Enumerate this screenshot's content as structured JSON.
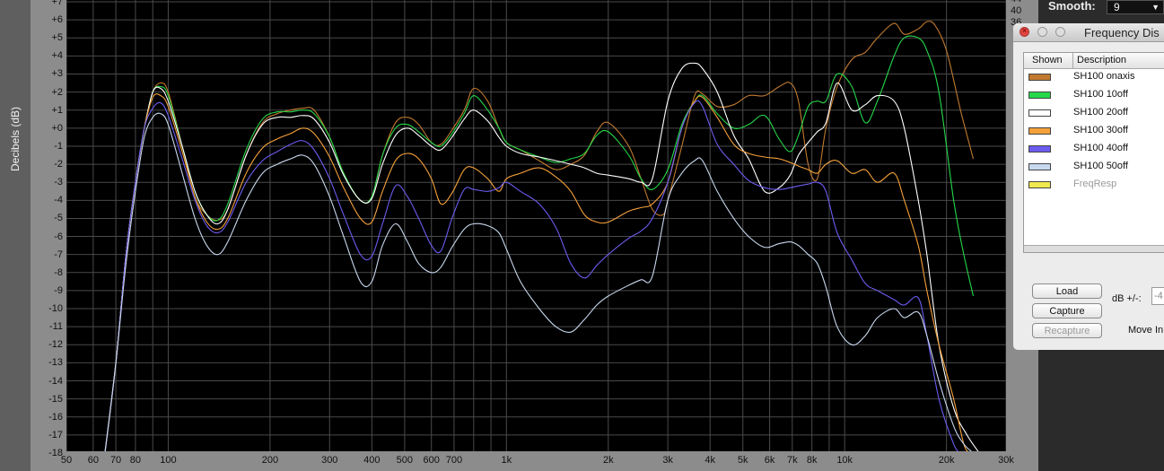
{
  "window_title": "Frequency Dis",
  "smooth": {
    "label": "Smooth:",
    "value": "9"
  },
  "table": {
    "columns": [
      "Shown",
      "Description"
    ],
    "rows": [
      {
        "label": "SH100 onaxis",
        "color": "#c27a2f",
        "dimmed": false
      },
      {
        "label": "SH100 10off",
        "color": "#25d84a",
        "dimmed": false
      },
      {
        "label": "SH100 20off",
        "color": "#ffffff",
        "dimmed": false
      },
      {
        "label": "SH100 30off",
        "color": "#f5a13a",
        "dimmed": false
      },
      {
        "label": "SH100 40off",
        "color": "#6c5cf0",
        "dimmed": false
      },
      {
        "label": "SH100 50off",
        "color": "#c8d8ee",
        "dimmed": false
      },
      {
        "label": "FreqResp",
        "color": "#f0e84c",
        "dimmed": true
      }
    ]
  },
  "buttons": {
    "load": "Load",
    "capture": "Capture",
    "recapture": "Recapture"
  },
  "db_label": "dB +/-:",
  "db_value": "-4",
  "move_label": "Move In",
  "right_axis_ticks": [
    "44",
    "40",
    "36"
  ],
  "chart_data": {
    "type": "line",
    "xscale": "log",
    "xlim": [
      50,
      30000
    ],
    "ylim": [
      -18,
      7
    ],
    "ylabel": "Decibels (dB)",
    "x_ticks": [
      {
        "v": 50,
        "t": "50"
      },
      {
        "v": 60,
        "t": "60"
      },
      {
        "v": 70,
        "t": "70"
      },
      {
        "v": 80,
        "t": "80"
      },
      {
        "v": 100,
        "t": "100"
      },
      {
        "v": 200,
        "t": "200"
      },
      {
        "v": 300,
        "t": "300"
      },
      {
        "v": 400,
        "t": "400"
      },
      {
        "v": 500,
        "t": "500"
      },
      {
        "v": 600,
        "t": "600"
      },
      {
        "v": 700,
        "t": "700"
      },
      {
        "v": 1000,
        "t": "1k"
      },
      {
        "v": 2000,
        "t": "2k"
      },
      {
        "v": 3000,
        "t": "3k"
      },
      {
        "v": 4000,
        "t": "4k"
      },
      {
        "v": 5000,
        "t": "5k"
      },
      {
        "v": 6000,
        "t": "6k"
      },
      {
        "v": 7000,
        "t": "7k"
      },
      {
        "v": 8000,
        "t": "8k"
      },
      {
        "v": 10000,
        "t": "10k"
      },
      {
        "v": 20000,
        "t": "20k"
      },
      {
        "v": 30000,
        "t": "30k"
      }
    ],
    "y_ticks": [
      {
        "v": 7,
        "t": "+7"
      },
      {
        "v": 6,
        "t": "+6"
      },
      {
        "v": 5,
        "t": "+5"
      },
      {
        "v": 4,
        "t": "+4"
      },
      {
        "v": 3,
        "t": "+3"
      },
      {
        "v": 2,
        "t": "+2"
      },
      {
        "v": 1,
        "t": "+1"
      },
      {
        "v": 0,
        "t": "+0"
      },
      {
        "v": -1,
        "t": "-1"
      },
      {
        "v": -2,
        "t": "-2"
      },
      {
        "v": -3,
        "t": "-3"
      },
      {
        "v": -4,
        "t": "-4"
      },
      {
        "v": -5,
        "t": "-5"
      },
      {
        "v": -6,
        "t": "-6"
      },
      {
        "v": -7,
        "t": "-7"
      },
      {
        "v": -8,
        "t": "-8"
      },
      {
        "v": -9,
        "t": "-9"
      },
      {
        "v": -10,
        "t": "-10"
      },
      {
        "v": -11,
        "t": "-11"
      },
      {
        "v": -12,
        "t": "-12"
      },
      {
        "v": -13,
        "t": "-13"
      },
      {
        "v": -14,
        "t": "-14"
      },
      {
        "v": -15,
        "t": "-15"
      },
      {
        "v": -16,
        "t": "-16"
      },
      {
        "v": -17,
        "t": "-17"
      },
      {
        "v": -18,
        "t": "-18"
      }
    ],
    "grid": true,
    "series": [
      {
        "name": "SH100 onaxis",
        "color": "#c27a2f",
        "x": [
          65,
          70,
          75,
          80,
          85,
          90,
          95,
          100,
          110,
          120,
          130,
          140,
          150,
          170,
          190,
          210,
          230,
          250,
          270,
          300,
          330,
          370,
          400,
          430,
          470,
          510,
          550,
          600,
          640,
          690,
          750,
          800,
          880,
          950,
          1000,
          1100,
          1250,
          1400,
          1550,
          1700,
          1850,
          2000,
          2300,
          2500,
          2700,
          2900,
          3000,
          3300,
          3600,
          3800,
          4200,
          4700,
          5200,
          5800,
          6400,
          6900,
          7300,
          7800,
          8300,
          8800,
          9500,
          10500,
          11500,
          12500,
          14000,
          15000,
          16500,
          17500,
          18500,
          20000,
          22000,
          24000
        ],
        "y": [
          -18,
          -13,
          -7,
          -3,
          0,
          2,
          2.5,
          2,
          -1,
          -3.8,
          -4.8,
          -5.1,
          -4.5,
          -1.5,
          0.3,
          0.8,
          1,
          1.1,
          1,
          -0.5,
          -2.5,
          -4,
          -3.8,
          -1.5,
          0.3,
          0.6,
          0.2,
          -0.8,
          -0.9,
          -0.1,
          1,
          2.2,
          1.5,
          0,
          -0.8,
          -1.2,
          -1.8,
          -2.3,
          -2,
          -1.5,
          -0.2,
          0.3,
          -1,
          -2.8,
          -4.5,
          -4.8,
          -4,
          -1,
          1.8,
          1.9,
          1.2,
          1.3,
          1.8,
          1.8,
          2.3,
          2.5,
          1.5,
          -2,
          -2.8,
          0,
          2.3,
          3.8,
          4.2,
          5,
          5.8,
          5.2,
          5.5,
          5.9,
          5.7,
          4.3,
          1,
          -1.7
        ]
      },
      {
        "name": "SH100 10off",
        "color": "#25d84a",
        "x": [
          65,
          70,
          75,
          80,
          85,
          90,
          95,
          100,
          110,
          120,
          130,
          140,
          150,
          170,
          190,
          210,
          230,
          250,
          270,
          300,
          330,
          370,
          400,
          430,
          470,
          510,
          550,
          600,
          640,
          690,
          750,
          800,
          880,
          950,
          1000,
          1100,
          1250,
          1400,
          1550,
          1700,
          1850,
          2000,
          2300,
          2500,
          2700,
          3000,
          3300,
          3600,
          3800,
          4200,
          4700,
          5200,
          5800,
          6400,
          6900,
          7300,
          7800,
          8300,
          8800,
          9500,
          10500,
          11500,
          12500,
          14000,
          15000,
          16500,
          17500,
          19000,
          21000,
          22500,
          24000
        ],
        "y": [
          -18,
          -13,
          -7,
          -3,
          0,
          2,
          2.3,
          1.8,
          -1,
          -3.5,
          -4.8,
          -5.1,
          -4.2,
          -1.2,
          0.5,
          0.9,
          0.9,
          1,
          0.8,
          -0.5,
          -2.5,
          -4,
          -3.8,
          -1.5,
          0,
          0.2,
          -0.2,
          -0.8,
          -1,
          -0.3,
          0.8,
          1.8,
          1,
          0,
          -0.8,
          -1.2,
          -1.6,
          -1.9,
          -1.7,
          -1.4,
          -0.4,
          -0.2,
          -1.5,
          -2.8,
          -3.4,
          -2.3,
          0.2,
          1.5,
          1.8,
          0.8,
          0,
          0.2,
          0.7,
          -0.6,
          -1.3,
          -0.4,
          1.2,
          1.5,
          1.5,
          3,
          2.3,
          0.3,
          1.5,
          4,
          5,
          5,
          4.3,
          2,
          -4,
          -7,
          -9.3
        ]
      },
      {
        "name": "SH100 20off",
        "color": "#ffffff",
        "x": [
          65,
          70,
          75,
          80,
          85,
          90,
          95,
          100,
          110,
          120,
          130,
          140,
          150,
          170,
          190,
          210,
          230,
          250,
          270,
          300,
          330,
          370,
          400,
          430,
          470,
          510,
          550,
          600,
          640,
          690,
          750,
          800,
          880,
          950,
          1000,
          1100,
          1250,
          1400,
          1550,
          1700,
          1850,
          2000,
          2300,
          2500,
          2700,
          3000,
          3300,
          3600,
          3800,
          4200,
          4700,
          5200,
          5800,
          6400,
          6900,
          7300,
          7800,
          8300,
          8800,
          9500,
          10500,
          11500,
          12500,
          14000,
          15000,
          16500,
          17500,
          19000,
          21000,
          23000,
          25000
        ],
        "y": [
          -18,
          -13,
          -7,
          -3,
          0,
          2,
          2.2,
          1.5,
          -1,
          -3.5,
          -4.8,
          -5.3,
          -4.5,
          -1.5,
          0.2,
          0.6,
          0.6,
          0.7,
          0.5,
          -0.8,
          -2.6,
          -4,
          -3.9,
          -2,
          -0.4,
          0,
          -0.4,
          -1,
          -1.2,
          -0.5,
          0.5,
          1,
          0.4,
          -0.5,
          -1,
          -1.4,
          -1.6,
          -1.8,
          -2,
          -2.2,
          -2.5,
          -2.6,
          -2.8,
          -3,
          -2.8,
          1.5,
          3.3,
          3.6,
          3.3,
          2,
          -0.4,
          -1.7,
          -3.5,
          -3.3,
          -2.6,
          -1.5,
          -0.8,
          -0.2,
          0.3,
          2.5,
          1,
          1.3,
          1.8,
          1.5,
          0,
          -4,
          -7,
          -12,
          -15.5,
          -17,
          -18
        ]
      },
      {
        "name": "SH100 30off",
        "color": "#f5a13a",
        "x": [
          65,
          70,
          75,
          80,
          85,
          90,
          95,
          100,
          110,
          120,
          130,
          140,
          150,
          170,
          190,
          210,
          230,
          250,
          270,
          300,
          330,
          370,
          400,
          430,
          470,
          510,
          550,
          600,
          640,
          690,
          750,
          800,
          880,
          950,
          1000,
          1100,
          1250,
          1400,
          1550,
          1700,
          1850,
          2000,
          2300,
          2500,
          2700,
          3000,
          3300,
          3600,
          3800,
          4200,
          4700,
          5200,
          5800,
          6400,
          6900,
          7300,
          7800,
          8300,
          8800,
          9500,
          10500,
          11500,
          12500,
          14000,
          15000,
          16500,
          17500,
          19000,
          21000,
          22500,
          23500
        ],
        "y": [
          -18,
          -13,
          -7,
          -3,
          0,
          1.7,
          1.8,
          1.2,
          -1.3,
          -3.8,
          -5.2,
          -5.6,
          -5,
          -2.5,
          -1.1,
          -0.6,
          -0.3,
          0,
          -0.3,
          -1.6,
          -3.3,
          -5,
          -5.2,
          -3.5,
          -1.8,
          -1.4,
          -1.7,
          -2.8,
          -4.2,
          -3.6,
          -2.3,
          -2.2,
          -2.8,
          -3.5,
          -2.8,
          -2.5,
          -2.2,
          -2.7,
          -3.5,
          -4.8,
          -5.2,
          -5.2,
          -4.6,
          -4.4,
          -4.2,
          -3,
          0,
          1.5,
          1.7,
          0.6,
          -0.9,
          -1.4,
          -1.6,
          -1.7,
          -1.9,
          -2.1,
          -2.3,
          -2.5,
          -2,
          -1.8,
          -2.5,
          -2.3,
          -3,
          -2.5,
          -4,
          -6.5,
          -9,
          -12,
          -15,
          -17.5,
          -18
        ]
      },
      {
        "name": "SH100 40off",
        "color": "#6c5cf0",
        "x": [
          65,
          70,
          75,
          80,
          85,
          90,
          95,
          100,
          110,
          120,
          130,
          140,
          150,
          170,
          190,
          210,
          230,
          250,
          270,
          300,
          330,
          370,
          400,
          430,
          470,
          510,
          550,
          600,
          640,
          690,
          750,
          800,
          880,
          950,
          1000,
          1100,
          1250,
          1400,
          1550,
          1700,
          1850,
          2000,
          2300,
          2500,
          2700,
          3000,
          3300,
          3600,
          3800,
          4200,
          4700,
          5200,
          5800,
          6400,
          6900,
          7300,
          7800,
          8300,
          8800,
          9500,
          10500,
          11500,
          12500,
          14000,
          15000,
          16500,
          17500,
          19000,
          21000,
          22000
        ],
        "y": [
          -18,
          -13,
          -7,
          -3,
          0,
          1.1,
          1.4,
          0.7,
          -1.7,
          -4,
          -5.4,
          -5.8,
          -5.2,
          -3,
          -1.8,
          -1.3,
          -0.9,
          -0.7,
          -1.2,
          -2.8,
          -4.8,
          -7,
          -7.1,
          -5.3,
          -3.2,
          -3.8,
          -5,
          -6.5,
          -6.8,
          -5,
          -3.4,
          -3.4,
          -3.5,
          -3.3,
          -3,
          -3.5,
          -4.2,
          -5.5,
          -7.5,
          -8.3,
          -7.6,
          -7,
          -6.1,
          -5.7,
          -5,
          -3,
          0,
          1.4,
          1.2,
          -0.9,
          -2,
          -2.9,
          -3.3,
          -3.4,
          -3.3,
          -3.2,
          -3.1,
          -3,
          -3.5,
          -5.8,
          -7.3,
          -8.6,
          -9,
          -9.5,
          -9.8,
          -9.4,
          -11.5,
          -15,
          -17.5,
          -18
        ]
      },
      {
        "name": "SH100 50off",
        "color": "#c8d8ee",
        "x": [
          65,
          70,
          75,
          80,
          85,
          90,
          95,
          100,
          110,
          120,
          130,
          140,
          150,
          170,
          190,
          210,
          230,
          250,
          270,
          300,
          330,
          370,
          400,
          430,
          470,
          510,
          550,
          600,
          640,
          690,
          750,
          800,
          880,
          950,
          1000,
          1100,
          1250,
          1400,
          1550,
          1700,
          1850,
          2000,
          2300,
          2500,
          2700,
          3000,
          3300,
          3600,
          3800,
          4200,
          4700,
          5200,
          5800,
          6400,
          6900,
          7300,
          7800,
          8300,
          8800,
          9500,
          10500,
          11500,
          12500,
          14000,
          15000,
          16500,
          17500,
          19000,
          21000,
          22500,
          24000
        ],
        "y": [
          -18,
          -13,
          -7.5,
          -3.5,
          -0.5,
          0.6,
          0.8,
          0.2,
          -2.5,
          -5,
          -6.5,
          -7,
          -6.3,
          -4,
          -2.5,
          -2,
          -1.7,
          -1.5,
          -2,
          -3.8,
          -6,
          -8.5,
          -8.5,
          -6.5,
          -5.3,
          -6.3,
          -7.5,
          -8,
          -7.7,
          -6.6,
          -5.6,
          -5.3,
          -5.4,
          -5.8,
          -6.7,
          -8.5,
          -10,
          -11,
          -11.3,
          -10.6,
          -9.8,
          -9.3,
          -8.7,
          -8.4,
          -8.2,
          -4,
          -2.5,
          -1.8,
          -1.8,
          -3.5,
          -5,
          -6,
          -6.6,
          -6.4,
          -6.3,
          -6.5,
          -7,
          -7.5,
          -8.8,
          -11,
          -12,
          -11.5,
          -10.5,
          -10,
          -10.5,
          -10.2,
          -11.5,
          -14,
          -16.5,
          -17.5,
          -18
        ]
      }
    ]
  }
}
